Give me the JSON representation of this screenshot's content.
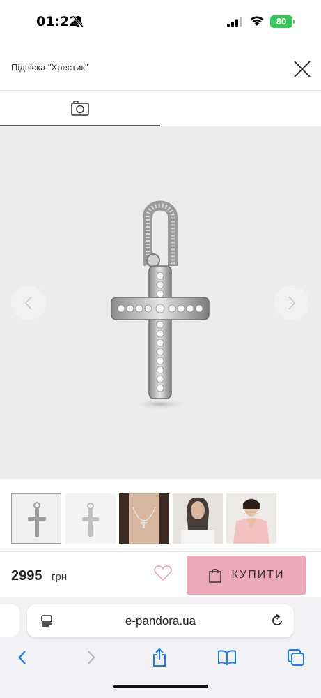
{
  "status": {
    "time": "01:22",
    "battery": "80"
  },
  "header": {
    "title": "Підвіска \"Хрестик\""
  },
  "icons": {
    "camera": "camera-icon",
    "close": "close-icon",
    "arrow_left": "chevron-left-icon",
    "arrow_right": "chevron-right-icon",
    "heart": "heart-icon",
    "bag": "shopping-bag-icon"
  },
  "product": {
    "price": "2995",
    "currency": "грн",
    "buy_label": "КУПИТИ",
    "thumbnail_count": 5,
    "selected_thumbnail": 1
  },
  "browser": {
    "url": "e-pandora.ua"
  },
  "colors": {
    "accent": "#eba8b6",
    "battery": "#34c759",
    "ios_blue": "#1a7cf2"
  }
}
